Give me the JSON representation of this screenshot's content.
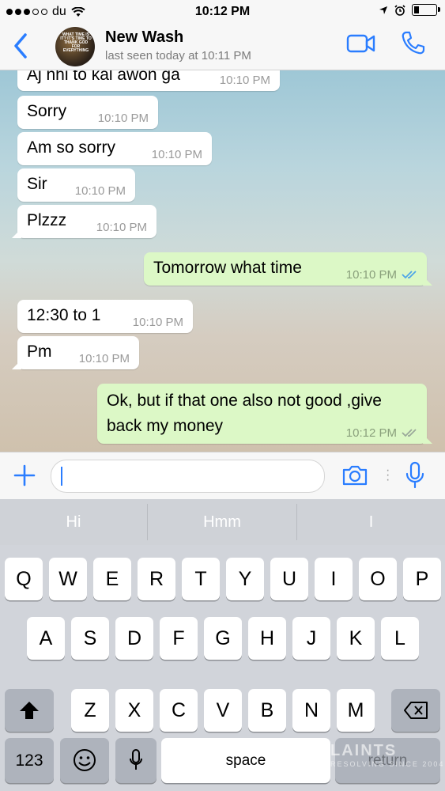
{
  "status_bar": {
    "carrier": "du",
    "time": "10:12 PM"
  },
  "header": {
    "contact_name": "New Wash",
    "last_seen": "last seen today at 10:11 PM",
    "avatar_text": "WHAT TIME IS IT? IT'S TIME TO THANK GOD FOR EVERYTHING"
  },
  "messages": [
    {
      "direction": "in",
      "text": "Aj nhi to kal awon ga",
      "time": "10:10 PM"
    },
    {
      "direction": "in",
      "text": "Sorry",
      "time": "10:10 PM"
    },
    {
      "direction": "in",
      "text": "Am so sorry",
      "time": "10:10 PM"
    },
    {
      "direction": "in",
      "text": "Sir",
      "time": "10:10 PM"
    },
    {
      "direction": "in",
      "text": "Plzzz",
      "time": "10:10 PM"
    },
    {
      "direction": "out",
      "text": "Tomorrow what time",
      "time": "10:10 PM",
      "status": "read"
    },
    {
      "direction": "in",
      "text": "12:30 to 1",
      "time": "10:10 PM"
    },
    {
      "direction": "in",
      "text": "Pm",
      "time": "10:10 PM"
    },
    {
      "direction": "out",
      "text_lines": [
        "Ok, but if that one also not good ,give",
        "back my money"
      ],
      "time": "10:12 PM",
      "status": "delivered"
    }
  ],
  "input": {
    "value": "",
    "placeholder": ""
  },
  "keyboard": {
    "suggestions": [
      "Hi",
      "Hmm",
      "I"
    ],
    "row1": [
      "Q",
      "W",
      "E",
      "R",
      "T",
      "Y",
      "U",
      "I",
      "O",
      "P"
    ],
    "row2": [
      "A",
      "S",
      "D",
      "F",
      "G",
      "H",
      "J",
      "K",
      "L"
    ],
    "row3": [
      "Z",
      "X",
      "C",
      "V",
      "B",
      "N",
      "M"
    ],
    "numbers_label": "123",
    "space_label": "space",
    "return_label": "return"
  },
  "watermark": {
    "text": "LAINTS",
    "subtext": "RESOLVING SINCE 2004"
  },
  "colors": {
    "accent": "#2a7dff",
    "outgoing_bubble": "#dcf8c6",
    "incoming_bubble": "#ffffff",
    "read_ticks": "#4fa6e8"
  }
}
